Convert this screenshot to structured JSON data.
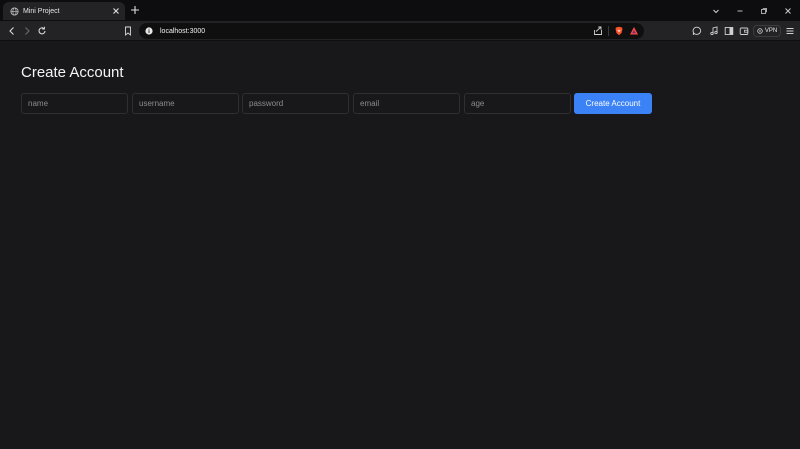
{
  "browser": {
    "tab_title": "Mini Project",
    "url": "localhost:3000",
    "vpn_label": "VPN",
    "icons": [
      "globe-icon",
      "close-icon",
      "plus-icon",
      "chevron-down-icon",
      "minimize-icon",
      "restore-icon",
      "window-close-icon",
      "back-icon",
      "forward-icon",
      "reload-icon",
      "bookmark-icon",
      "info-icon",
      "share-icon",
      "brave-shields-icon",
      "rewards-icon",
      "chat-icon",
      "music-icon",
      "sidebar-icon",
      "wallet-icon",
      "menu-icon"
    ]
  },
  "page": {
    "title": "Create Account",
    "fields": [
      {
        "name": "name",
        "placeholder": "name",
        "value": ""
      },
      {
        "name": "username",
        "placeholder": "username",
        "value": ""
      },
      {
        "name": "password",
        "placeholder": "password",
        "value": ""
      },
      {
        "name": "email",
        "placeholder": "email",
        "value": ""
      },
      {
        "name": "age",
        "placeholder": "age",
        "value": ""
      }
    ],
    "submit_label": "Create Account"
  },
  "colors": {
    "background": "#18181b",
    "accent": "#3b82f6",
    "input_border": "#2e2e33"
  }
}
